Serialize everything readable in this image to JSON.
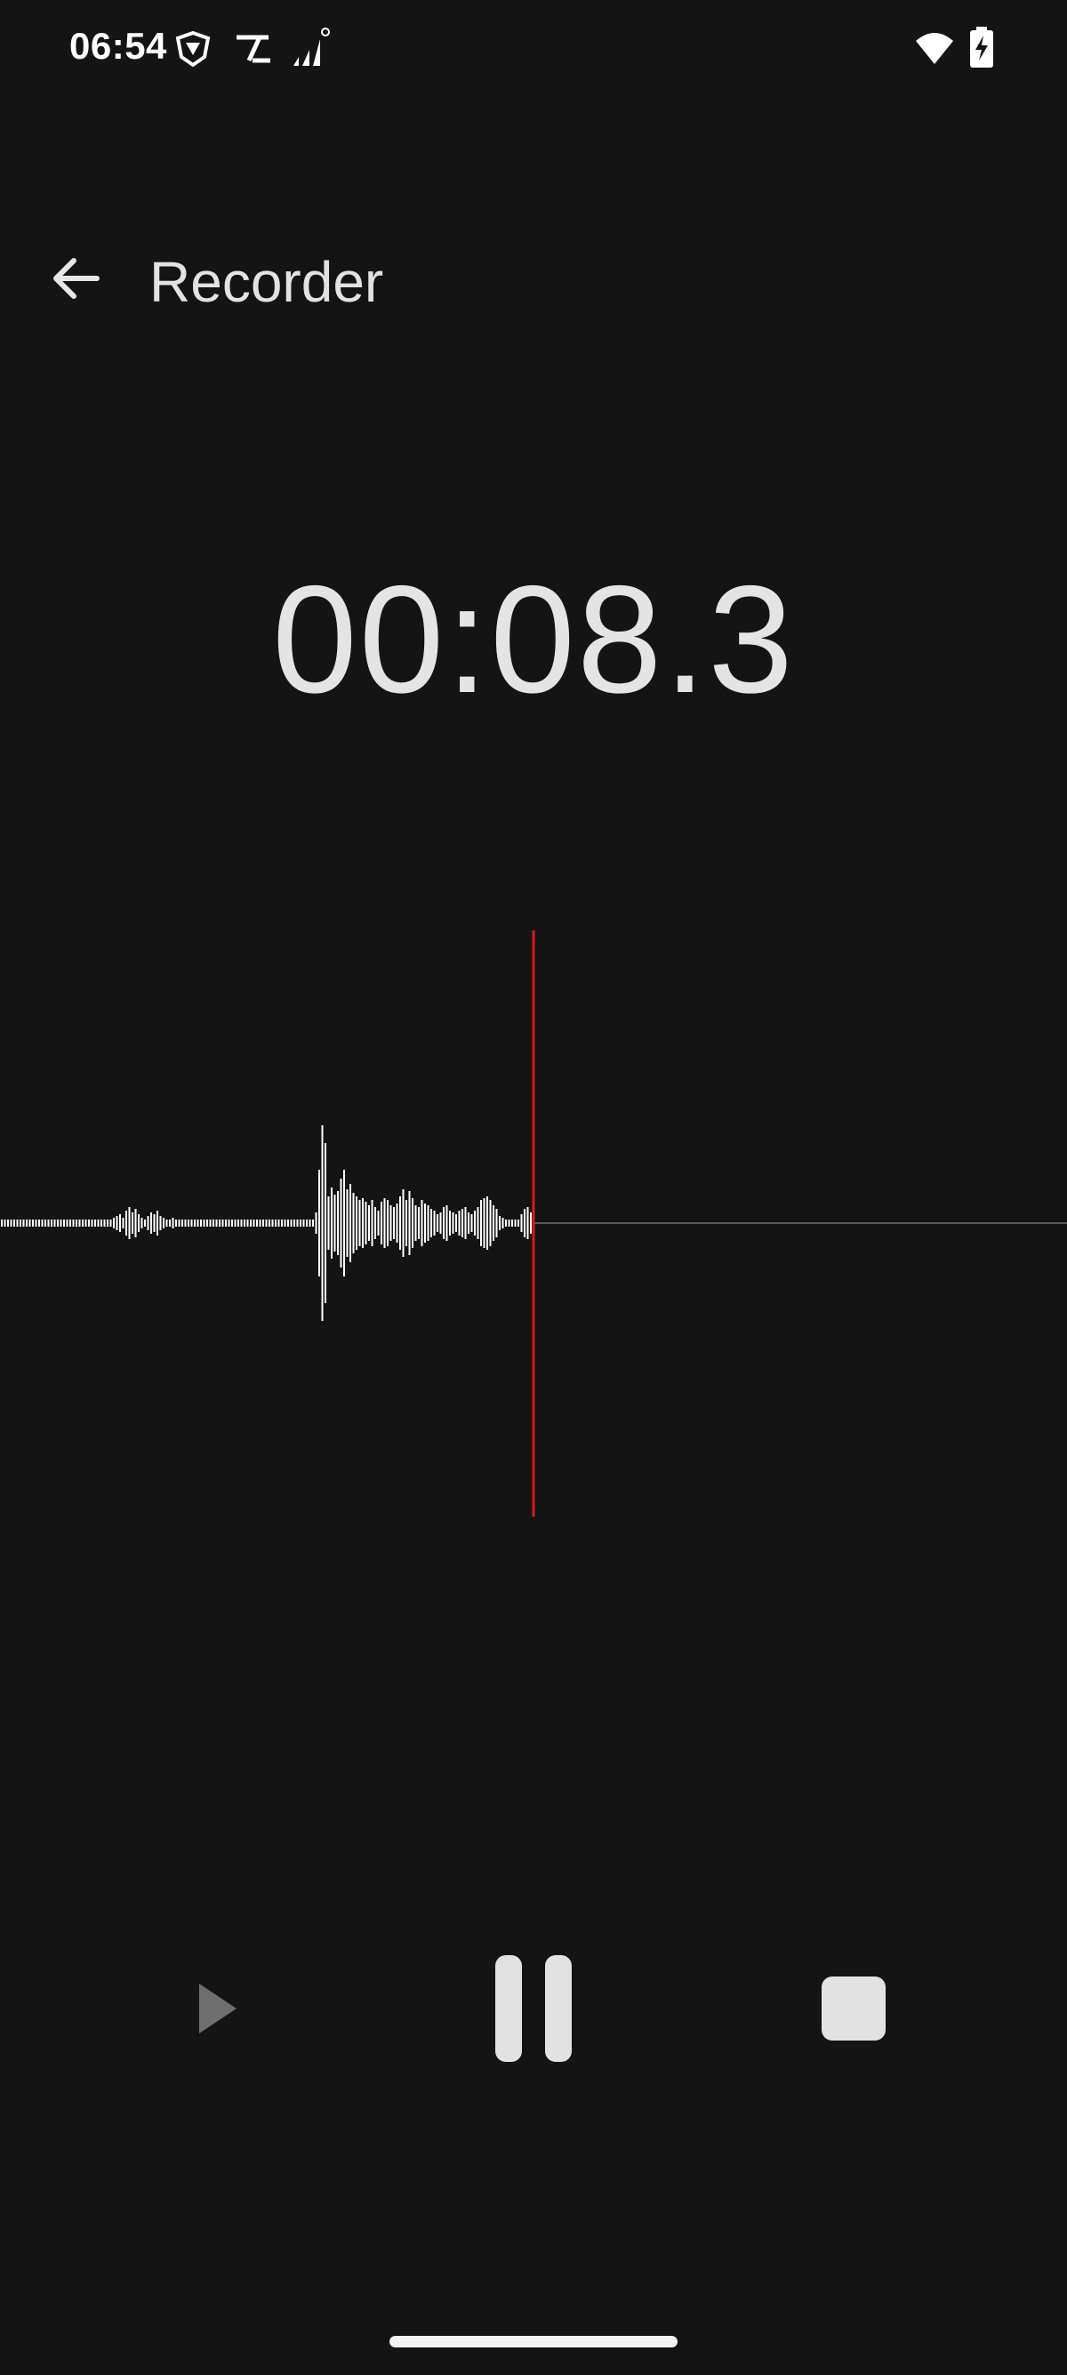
{
  "status_bar": {
    "time": "06:54",
    "left_icons": [
      "vpn-shield-icon",
      "app-notification-icon",
      "signal-bars-icon"
    ],
    "right_icons": [
      "wifi-icon",
      "battery-charging-icon"
    ]
  },
  "app_bar": {
    "back_icon": "arrow-left-icon",
    "title": "Recorder"
  },
  "recorder": {
    "elapsed": "00:08.3",
    "playhead_color": "#d81b1b",
    "waveform_color": "#ffffff",
    "baseline_color": "#5a5a5a"
  },
  "controls": {
    "play_icon": "play-icon",
    "pause_icon": "pause-icon",
    "stop_icon": "stop-icon"
  },
  "colors": {
    "background": "#141414",
    "text": "#e4e4e4"
  }
}
